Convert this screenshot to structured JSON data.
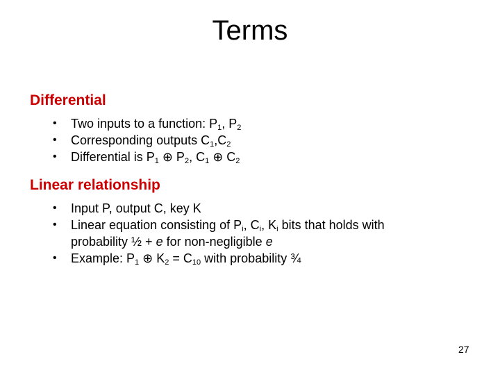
{
  "slide": {
    "title": "Terms",
    "page_number": "27",
    "accent_color": "#cc0000",
    "sections": [
      {
        "heading": "Differential",
        "bullets": [
          {
            "parts": [
              "Two inputs to a function: P",
              "1",
              ", P",
              "2"
            ]
          },
          {
            "parts": [
              "Corresponding outputs C",
              "1",
              ",C",
              "2"
            ]
          },
          {
            "parts": [
              "Differential is P",
              "1",
              " ⊕ P",
              "2",
              ", C",
              "1",
              " ⊕ C",
              "2"
            ]
          }
        ]
      },
      {
        "heading": "Linear relationship",
        "bullets": [
          {
            "text": "Input P, output C, key K"
          },
          {
            "parts": [
              "Linear equation consisting of P",
              "i",
              ", C",
              "i",
              ", K",
              "i",
              " bits that holds with"
            ],
            "line2_a": "probability ½ + ",
            "line2_e": "e",
            "line2_b": " for non-negligible ",
            "line2_e2": "e"
          },
          {
            "parts": [
              "Example: P",
              "1",
              " ⊕ K",
              "2",
              " = C",
              "10",
              " with probability ¾"
            ]
          }
        ]
      }
    ]
  }
}
